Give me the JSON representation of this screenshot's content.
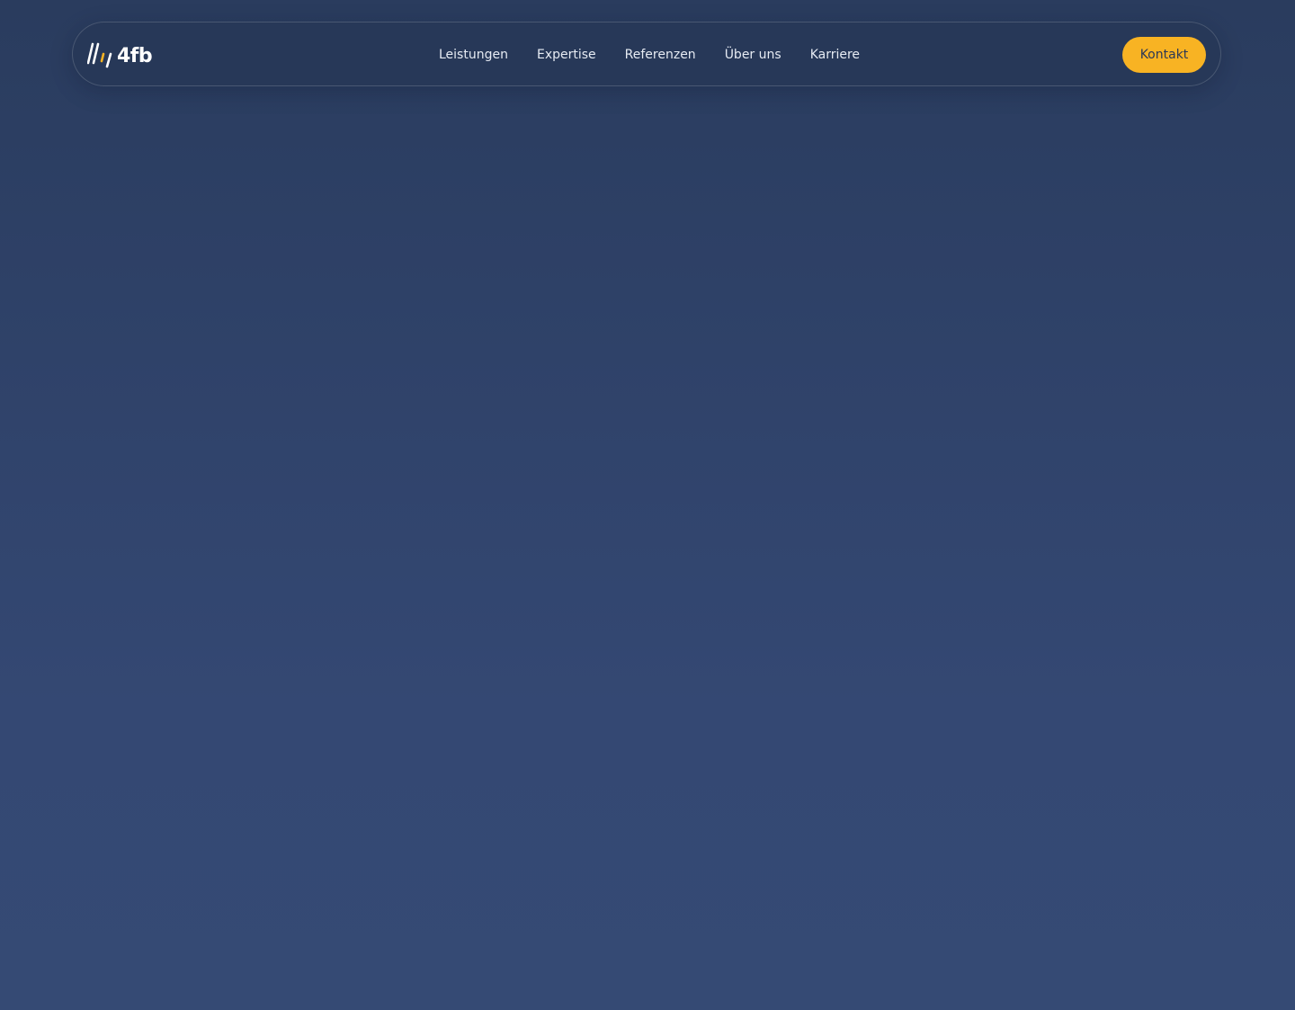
{
  "brand": {
    "name": "4fb",
    "logo_icon": "slashes-logo-icon",
    "accent_color": "#f8b323",
    "logo_stroke_white": "#ffffff"
  },
  "nav": {
    "links": [
      {
        "label": "Leistungen"
      },
      {
        "label": "Expertise"
      },
      {
        "label": "Referenzen"
      },
      {
        "label": "Über uns"
      },
      {
        "label": "Karriere"
      }
    ],
    "contact_label": "Kontakt"
  },
  "colors": {
    "background_top": "#2a3c5e",
    "background_bottom": "#354a74",
    "button_bg": "#f8b323",
    "button_text": "#2b3857",
    "link_text": "#e6ebf3"
  }
}
